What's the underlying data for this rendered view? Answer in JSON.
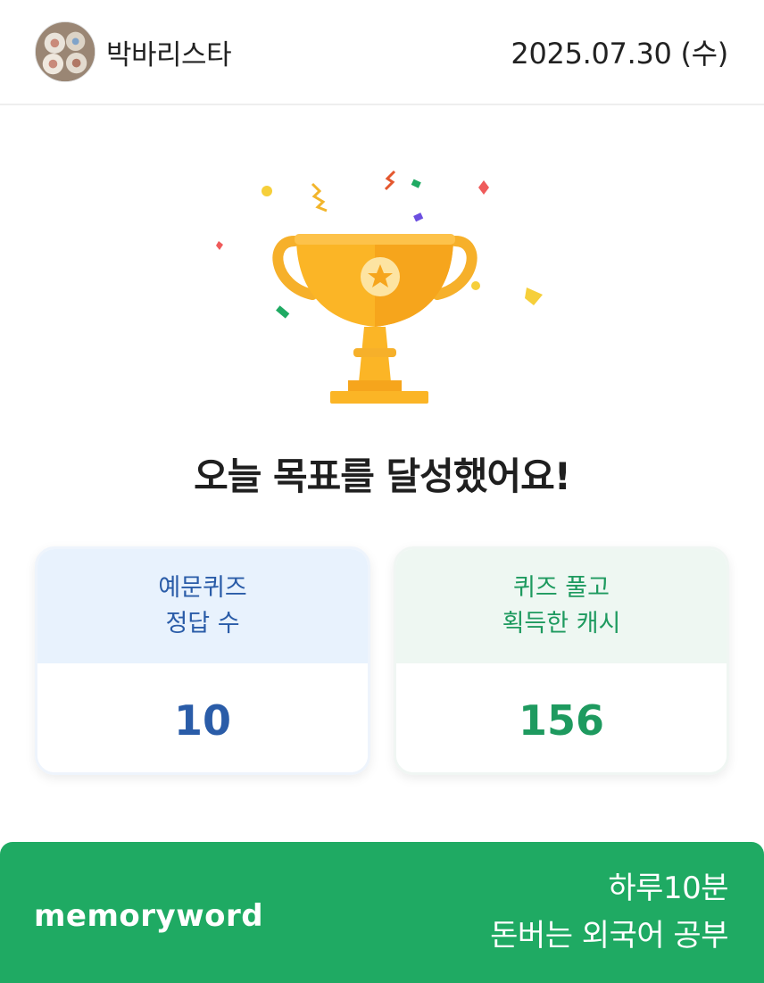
{
  "header": {
    "username": "박바리스타",
    "date": "2025.07.30 (수)",
    "avatar_icon": "user-avatar-photo"
  },
  "hero": {
    "icon": "trophy-icon",
    "headline": "오늘 목표를 달성했어요!"
  },
  "stats": [
    {
      "label_line1": "예문퀴즈",
      "label_line2": "정답 수",
      "value": "10",
      "color": "#2a5ca8"
    },
    {
      "label_line1": "퀴즈 풀고",
      "label_line2": "획득한 캐시",
      "value": "156",
      "color": "#1e9a5f"
    }
  ],
  "footer": {
    "brand": "memoryword",
    "slogan_line1": "하루10분",
    "slogan_line2": "돈버는 외국어 공부",
    "background": "#1faa63"
  }
}
